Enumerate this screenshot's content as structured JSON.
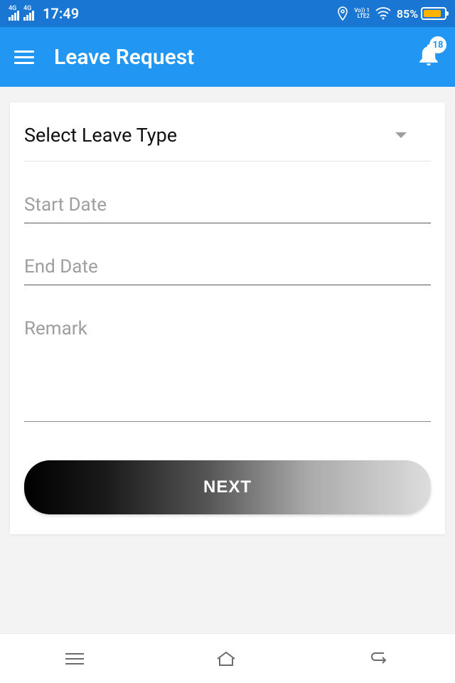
{
  "statusBar": {
    "signal1": "4G",
    "signal2": "4G",
    "time": "17:49",
    "volteTop": "Vo)) 1",
    "volteBottom": "LTE2",
    "batteryPct": "85%"
  },
  "appBar": {
    "title": "Leave Request",
    "badge": "18"
  },
  "form": {
    "leaveTypeLabel": "Select Leave Type",
    "startDatePlaceholder": "Start Date",
    "startDateValue": "",
    "endDatePlaceholder": "End Date",
    "endDateValue": "",
    "remarkPlaceholder": "Remark",
    "remarkValue": "",
    "nextLabel": "NEXT"
  }
}
